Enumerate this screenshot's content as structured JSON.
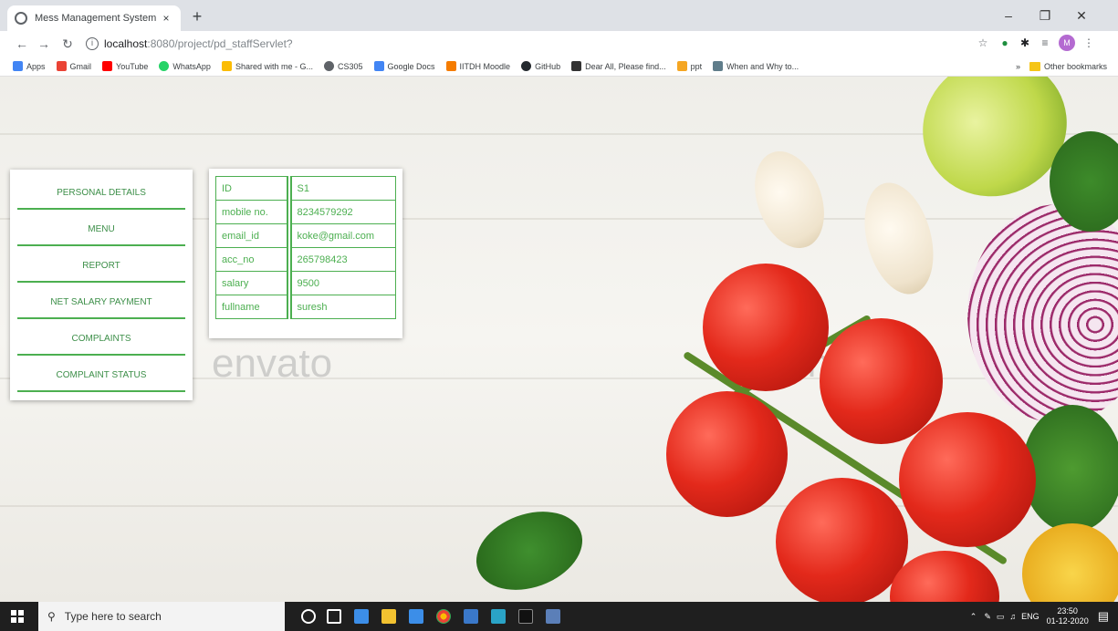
{
  "browser": {
    "tab_title": "Mess Management System",
    "tab_close": "×",
    "new_tab": "+",
    "url_host": "localhost",
    "url_path": ":8080/project/pd_staffServlet?",
    "window_controls": {
      "minimize": "–",
      "maximize": "❐",
      "close": "✕"
    }
  },
  "bookmarks": [
    {
      "label": "Apps",
      "color": "#4285f4"
    },
    {
      "label": "Gmail",
      "color": "#ea4335"
    },
    {
      "label": "YouTube",
      "color": "#ff0000"
    },
    {
      "label": "WhatsApp",
      "color": "#25d366"
    },
    {
      "label": "Shared with me - G...",
      "color": "#fbbc04"
    },
    {
      "label": "CS305",
      "color": "#5f6368"
    },
    {
      "label": "Google Docs",
      "color": "#4285f4"
    },
    {
      "label": "IITDH Moodle",
      "color": "#f57c00"
    },
    {
      "label": "GitHub",
      "color": "#24292e"
    },
    {
      "label": "Dear All, Please find...",
      "color": "#333333"
    },
    {
      "label": "ppt",
      "color": "#f5a623"
    },
    {
      "label": "When and Why to...",
      "color": "#607d8b"
    }
  ],
  "other_bookmarks": "Other bookmarks",
  "bookmarks_more": "»",
  "sidebar": {
    "items": [
      {
        "label": "PERSONAL DETAILS"
      },
      {
        "label": "MENU"
      },
      {
        "label": "REPORT"
      },
      {
        "label": "NET SALARY PAYMENT"
      },
      {
        "label": "COMPLAINTS"
      },
      {
        "label": "COMPLAINT STATUS"
      }
    ]
  },
  "details": {
    "rows": [
      {
        "key": "ID",
        "value": "S1"
      },
      {
        "key": "mobile no.",
        "value": "8234579292"
      },
      {
        "key": "email_id",
        "value": "koke@gmail.com"
      },
      {
        "key": "acc_no",
        "value": "265798423"
      },
      {
        "key": "salary",
        "value": "9500"
      },
      {
        "key": "fullname",
        "value": "suresh"
      }
    ]
  },
  "watermark": "envato",
  "taskbar": {
    "search_placeholder": "Type here to search",
    "lang": "ENG",
    "time": "23:50",
    "date": "01-12-2020"
  }
}
